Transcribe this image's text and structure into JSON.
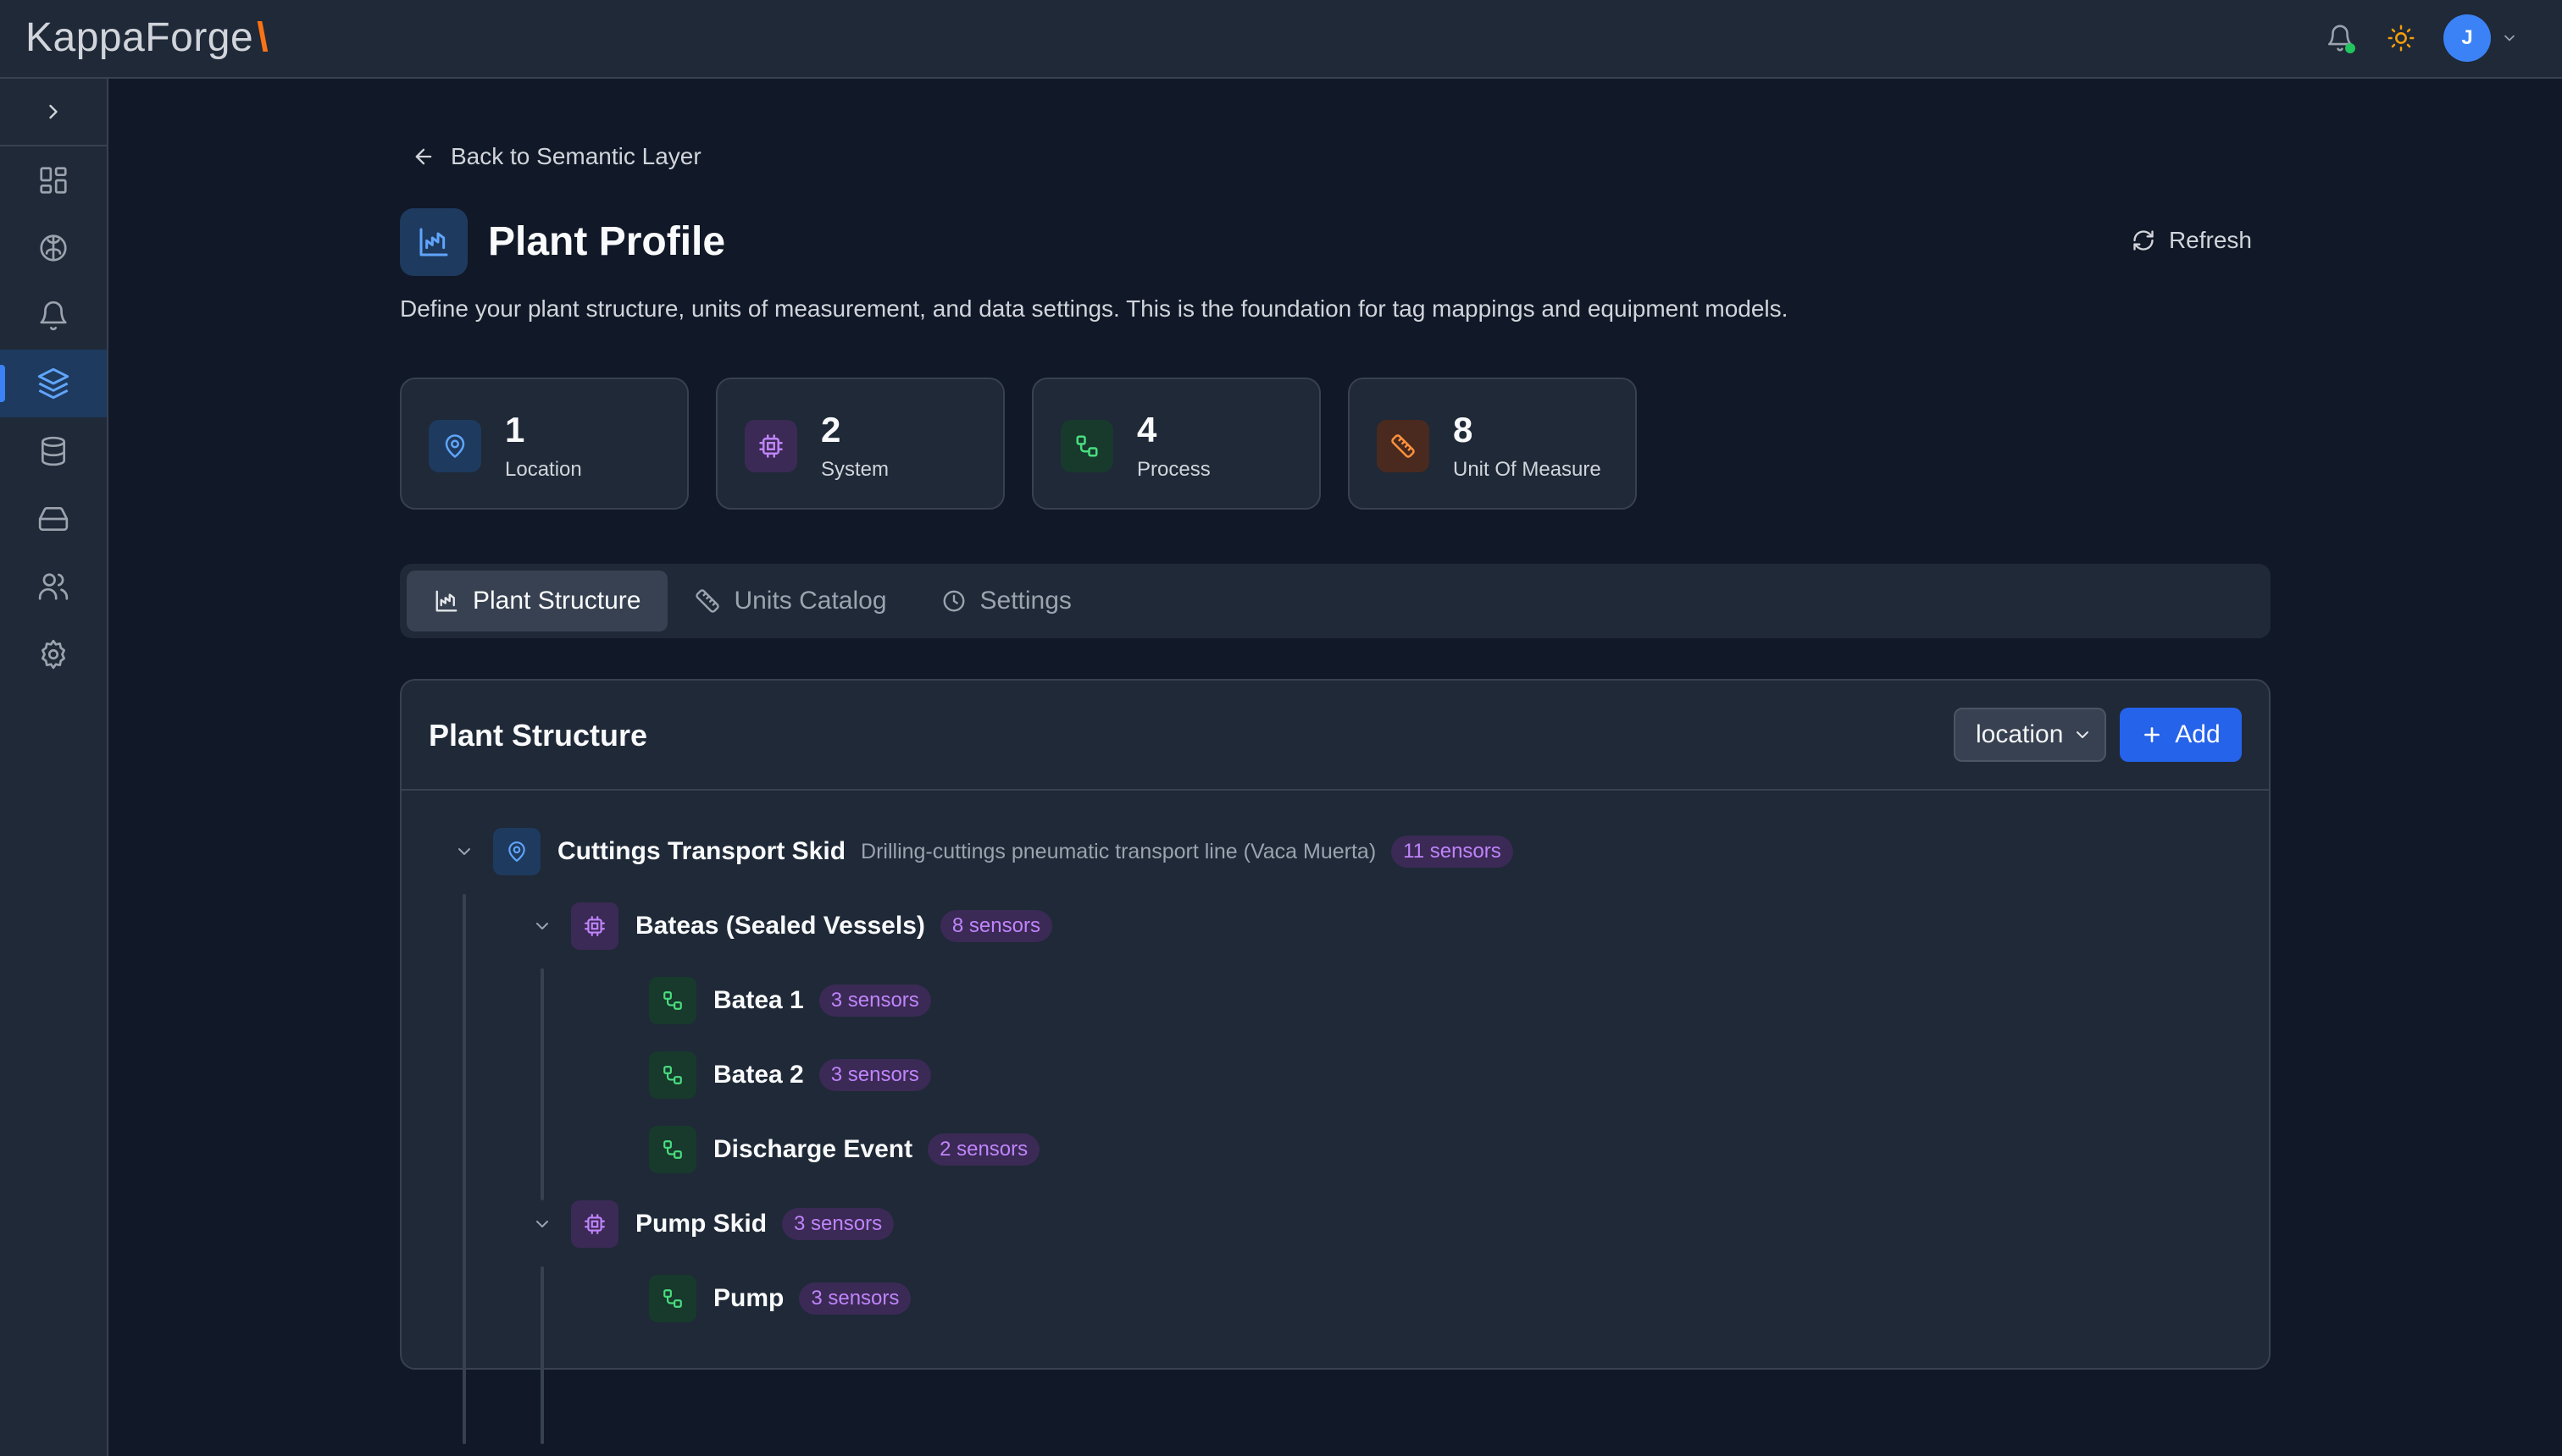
{
  "app": {
    "logo_text": "KappaForge",
    "logo_mark": "\\",
    "avatar_initial": "J"
  },
  "nav": {
    "items": [
      {
        "icon": "dashboard-icon",
        "active": false
      },
      {
        "icon": "brain-icon",
        "active": false
      },
      {
        "icon": "bell-icon",
        "active": false
      },
      {
        "icon": "layers-icon",
        "active": true
      },
      {
        "icon": "database-icon",
        "active": false
      },
      {
        "icon": "storage-drive-icon",
        "active": false
      },
      {
        "icon": "users-icon",
        "active": false
      },
      {
        "icon": "gear-icon",
        "active": false
      }
    ]
  },
  "page": {
    "back_label": "Back to Semantic Layer",
    "title": "Plant Profile",
    "refresh_label": "Refresh",
    "subtitle": "Define your plant structure, units of measurement, and data settings. This is the foundation for tag mappings and equipment models."
  },
  "stats": [
    {
      "value": "1",
      "label": "Location",
      "icon": "map-pin-icon",
      "color": "#3b82f6"
    },
    {
      "value": "2",
      "label": "System",
      "icon": "cpu-chip-icon",
      "color": "#a855f7"
    },
    {
      "value": "4",
      "label": "Process",
      "icon": "workflow-icon",
      "color": "#22c55e"
    },
    {
      "value": "8",
      "label": "Unit Of Measure",
      "icon": "ruler-icon",
      "color": "#f97316"
    }
  ],
  "tabs": [
    {
      "label": "Plant Structure",
      "icon": "chart-icon",
      "active": true
    },
    {
      "label": "Units Catalog",
      "icon": "ruler-icon",
      "active": false
    },
    {
      "label": "Settings",
      "icon": "clock-icon",
      "active": false
    }
  ],
  "structure": {
    "title": "Plant Structure",
    "level_select": "location",
    "add_label": "Add",
    "nodes": [
      {
        "name": "Cuttings Transport Skid",
        "desc": "Drilling-cuttings pneumatic transport line (Vaca Muerta)",
        "badge": "11 sensors",
        "kind": "location"
      },
      {
        "name": "Bateas (Sealed Vessels)",
        "desc": "",
        "badge": "8 sensors",
        "kind": "system"
      },
      {
        "name": "Batea 1",
        "desc": "",
        "badge": "3 sensors",
        "kind": "process"
      },
      {
        "name": "Batea 2",
        "desc": "",
        "badge": "3 sensors",
        "kind": "process"
      },
      {
        "name": "Discharge Event",
        "desc": "",
        "badge": "2 sensors",
        "kind": "process"
      },
      {
        "name": "Pump Skid",
        "desc": "",
        "badge": "3 sensors",
        "kind": "system"
      },
      {
        "name": "Pump",
        "desc": "",
        "badge": "3 sensors",
        "kind": "process"
      }
    ]
  },
  "colors": {
    "accent": "#2563eb",
    "badge_text": "#c084fc",
    "status_online": "#22c55e",
    "logo_mark": "#f97316"
  }
}
